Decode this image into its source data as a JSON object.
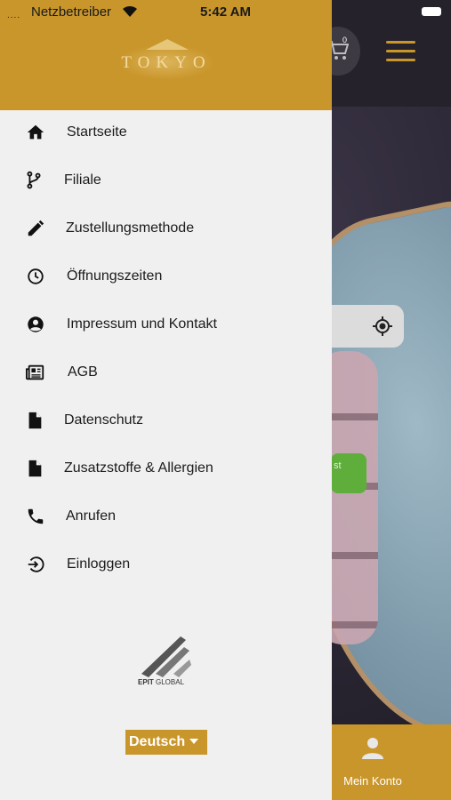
{
  "status_bar": {
    "signal": "....",
    "carrier": "Netzbetreiber",
    "time": "5:42 AM"
  },
  "drawer": {
    "logo_text": "TOKYO",
    "menu": [
      {
        "label": "Startseite",
        "icon": "home-icon"
      },
      {
        "label": "Filiale",
        "icon": "branch-icon"
      },
      {
        "label": "Zustellungsmethode",
        "icon": "pencil-icon"
      },
      {
        "label": "Öffnungszeiten",
        "icon": "clock-icon"
      },
      {
        "label": "Impressum und Kontakt",
        "icon": "account-circle-icon"
      },
      {
        "label": "AGB",
        "icon": "newspaper-icon"
      },
      {
        "label": "Datenschutz",
        "icon": "document-icon"
      },
      {
        "label": "Zusatzstoffe & Allergien",
        "icon": "document-icon"
      },
      {
        "label": "Anrufen",
        "icon": "phone-icon"
      },
      {
        "label": "Einloggen",
        "icon": "login-icon"
      }
    ],
    "brand_strong": "EPIT",
    "brand_rest": " GLOBAL",
    "language": "Deutsch"
  },
  "background_app": {
    "cart_count": "0",
    "bottom_nav_label": "Mein Konto",
    "ghost_text": "st"
  },
  "colors": {
    "accent": "#c9962b",
    "drawer_bg": "#f0f0f0"
  }
}
